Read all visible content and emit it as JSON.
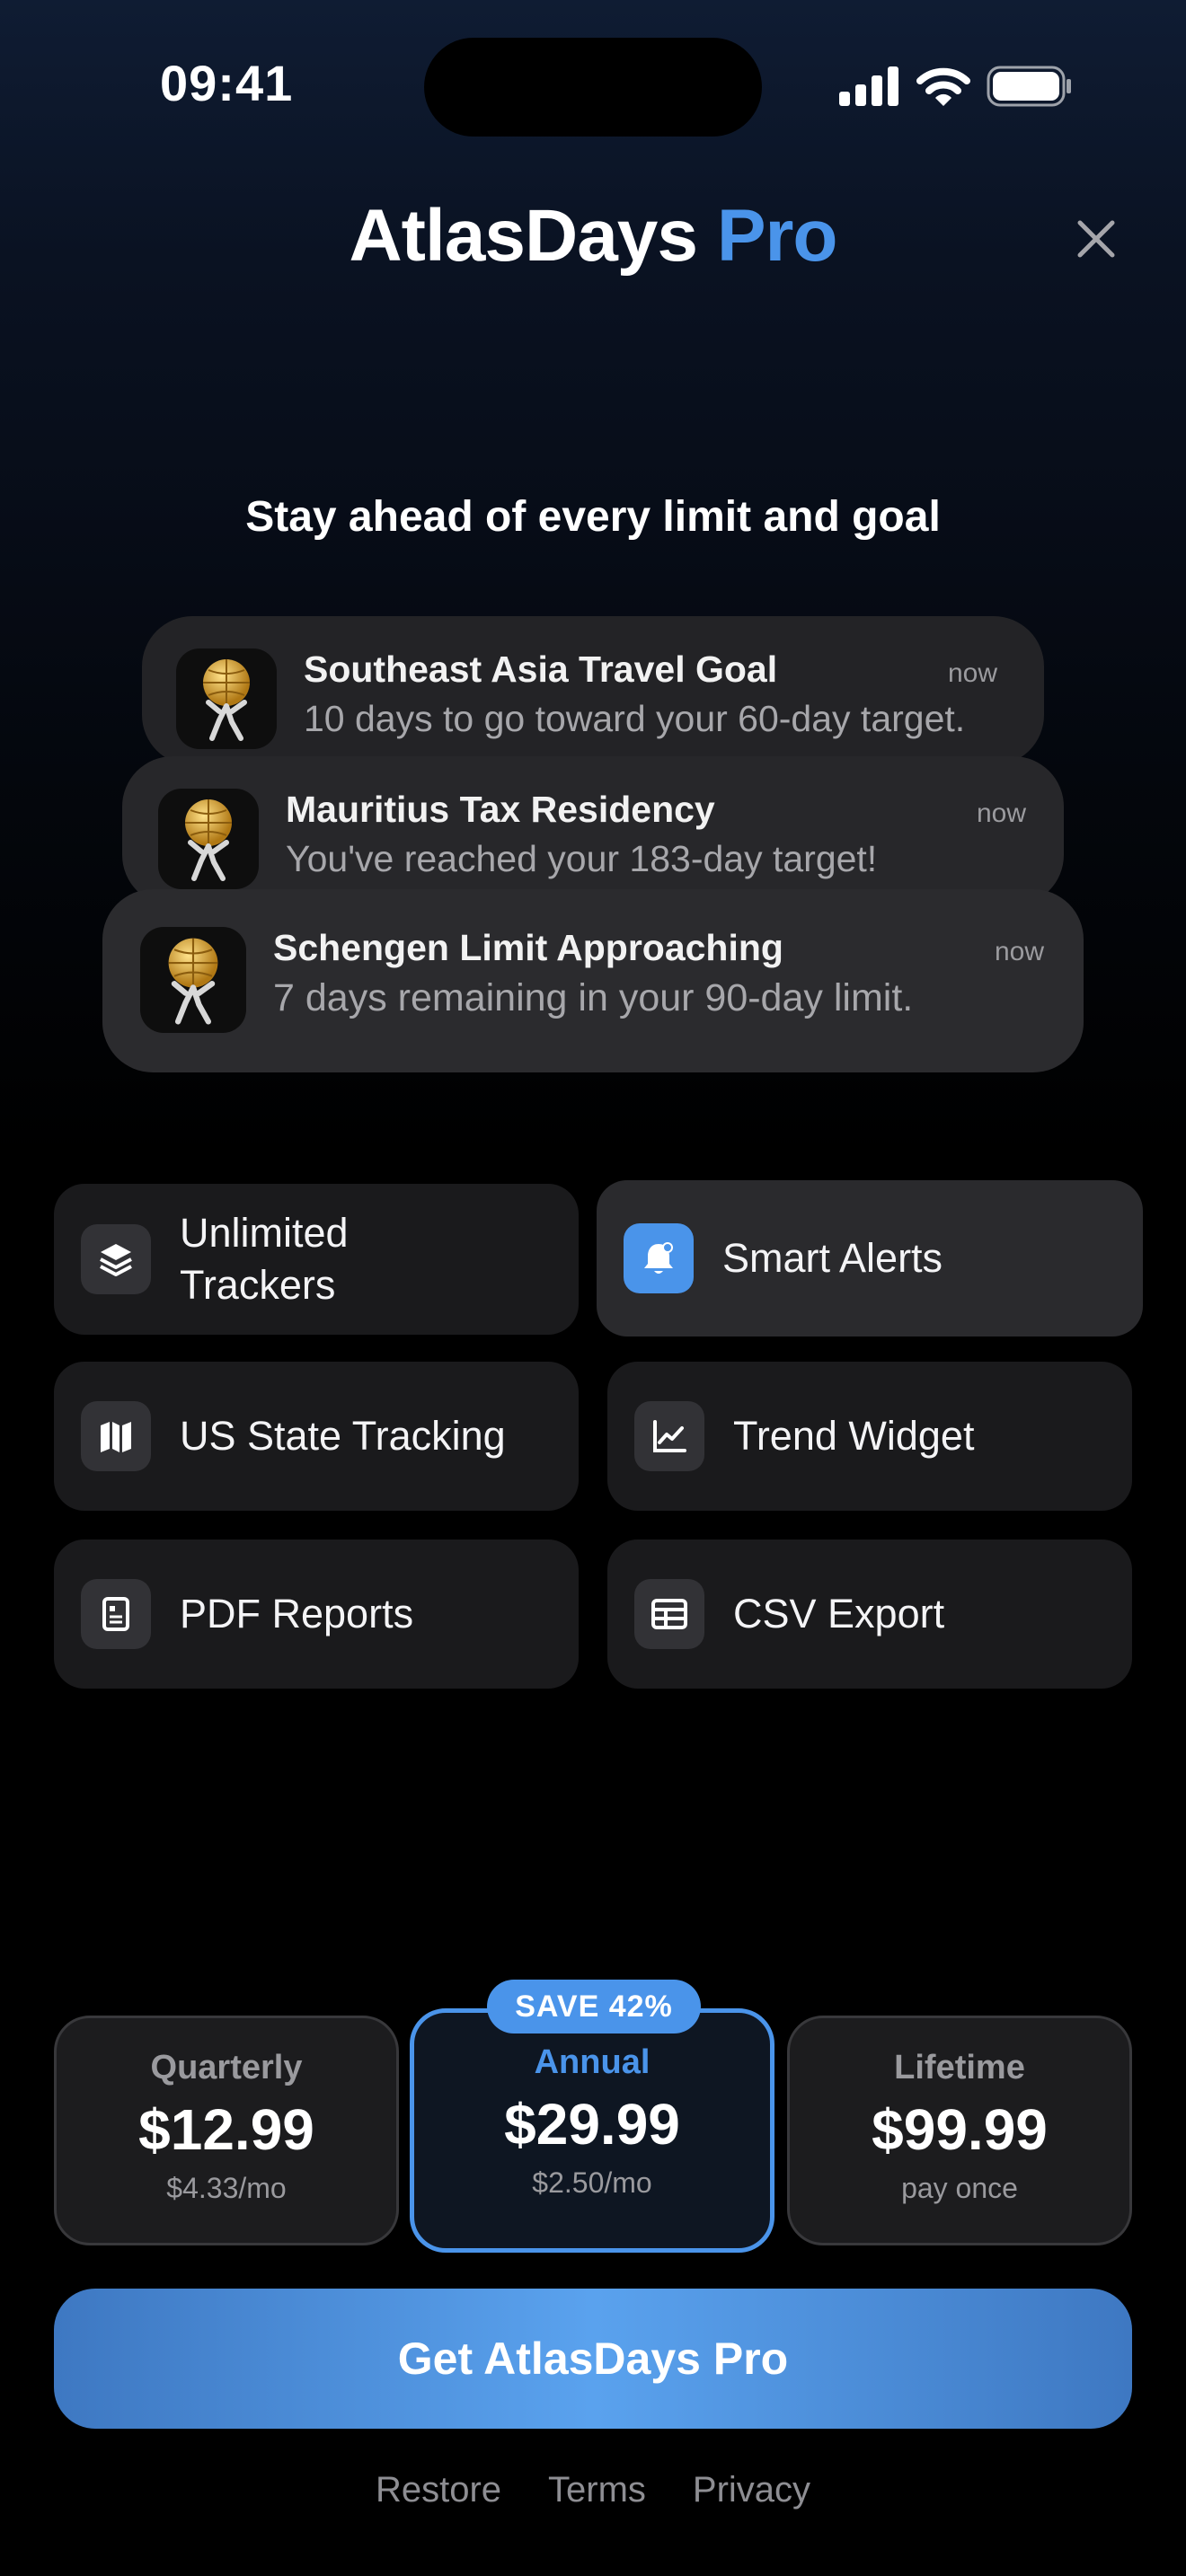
{
  "status": {
    "time": "09:41"
  },
  "header": {
    "title": "AtlasDays",
    "title_accent": "Pro",
    "close_icon": "close-icon"
  },
  "tagline": "Stay ahead of every limit and goal",
  "notifications": [
    {
      "title": "Southeast Asia Travel Goal",
      "time": "now",
      "message": "10 days to go toward your 60-day target.",
      "icon": "atlas-app-icon"
    },
    {
      "title": "Mauritius Tax Residency",
      "time": "now",
      "message": "You've reached your 183-day target!",
      "icon": "atlas-app-icon"
    },
    {
      "title": "Schengen Limit Approaching",
      "time": "now",
      "message": "7 days remaining in your 90-day limit.",
      "icon": "atlas-app-icon"
    }
  ],
  "features": [
    {
      "label": "Unlimited Trackers",
      "icon": "layers-icon"
    },
    {
      "label": "Smart Alerts",
      "icon": "bell-icon"
    },
    {
      "label": "US State Tracking",
      "icon": "map-icon"
    },
    {
      "label": "Trend Widget",
      "icon": "chart-line-icon"
    },
    {
      "label": "PDF Reports",
      "icon": "document-icon"
    },
    {
      "label": "CSV Export",
      "icon": "table-icon"
    }
  ],
  "plans": [
    {
      "name": "Quarterly",
      "price": "$12.99",
      "per": "$4.33/mo",
      "selected": false
    },
    {
      "name": "Annual",
      "price": "$29.99",
      "per": "$2.50/mo",
      "selected": true,
      "badge": "SAVE 42%"
    },
    {
      "name": "Lifetime",
      "price": "$99.99",
      "per": "pay once",
      "selected": false
    }
  ],
  "cta": "Get AtlasDays Pro",
  "footer_links": [
    "Restore",
    "Terms",
    "Privacy"
  ],
  "colors": {
    "accent": "#4a94ea",
    "card": "#1a1a1c"
  }
}
